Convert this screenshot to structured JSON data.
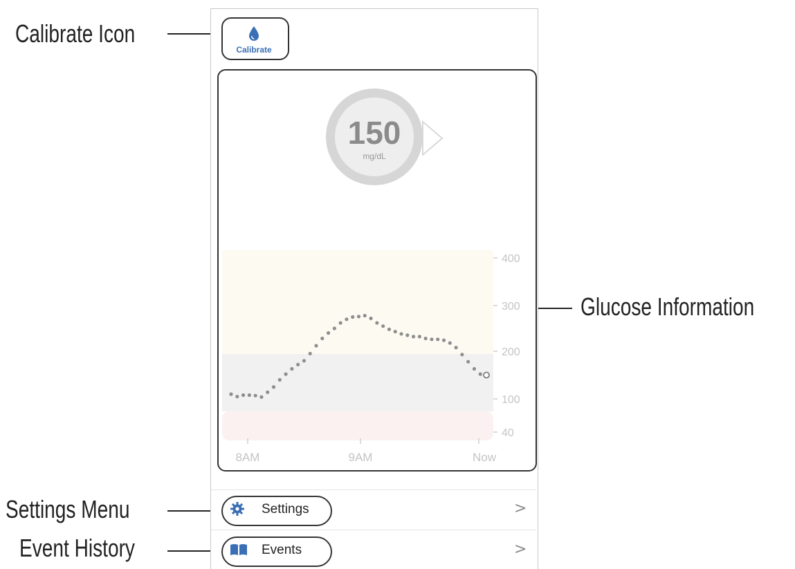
{
  "annotations": {
    "calibrate_icon": "Calibrate Icon",
    "glucose_information": "Glucose Information",
    "settings_menu": "Settings Menu",
    "event_history": "Event History"
  },
  "toolbar": {
    "calibrate_label": "Calibrate",
    "calibrate_icon": "drop-icon"
  },
  "glucose": {
    "value": "150",
    "unit": "mg/dL",
    "trend_icon": "trend-arrow-right"
  },
  "menu": {
    "settings": {
      "label": "Settings",
      "icon": "gear-icon",
      "chevron": ">"
    },
    "events": {
      "label": "Events",
      "icon": "book-icon",
      "chevron": ">"
    }
  },
  "colors": {
    "accent": "#3a6fb5",
    "high_zone": "#fdfaf2",
    "target_zone": "#f1f1f1",
    "low_zone": "#fcf1f1",
    "dots": "#8e8e8e"
  },
  "chart_data": {
    "type": "scatter",
    "y_ticks": [
      "400",
      "300",
      "200",
      "100",
      "40"
    ],
    "y_tick_values": [
      400,
      300,
      200,
      100,
      40
    ],
    "x_tick_labels": [
      "8AM",
      "9AM",
      "Now"
    ],
    "target_range": [
      80,
      200
    ],
    "ylim": [
      40,
      400
    ],
    "series": [
      {
        "values": [
          110,
          105,
          108,
          108,
          107,
          104,
          114,
          125,
          140,
          152,
          163,
          172,
          180,
          195,
          212,
          228,
          240,
          250,
          262,
          270,
          275,
          276,
          278,
          272,
          262,
          255,
          248,
          243,
          238,
          235,
          232,
          232,
          228,
          226,
          226,
          224,
          218,
          208,
          193,
          178,
          163,
          152,
          150
        ],
        "current_index": 42
      }
    ]
  }
}
